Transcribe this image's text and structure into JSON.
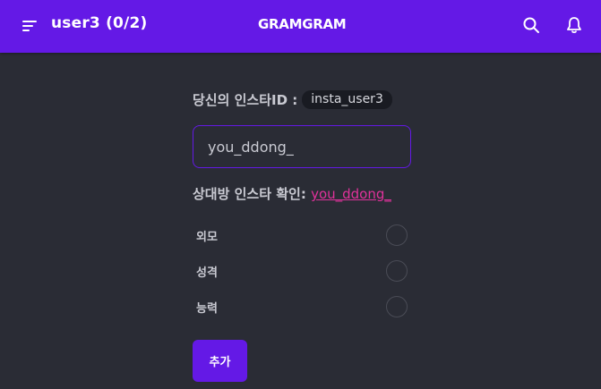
{
  "header": {
    "title": "user3 (0/2)",
    "brand": "GRAMGRAM",
    "icons": {
      "menu": "menu-icon",
      "search": "search-icon",
      "notifications": "bell-icon"
    }
  },
  "form": {
    "my_id_label": "당신의 인스타ID :",
    "my_id_value": "insta_user3",
    "target_input_value": "you_ddong_",
    "confirm_label": "상대방 인스타 확인:",
    "confirm_link": "you_ddong_",
    "options": [
      {
        "label": "외모",
        "checked": false
      },
      {
        "label": "성격",
        "checked": false
      },
      {
        "label": "능력",
        "checked": false
      }
    ],
    "add_button": "추가"
  },
  "colors": {
    "primary": "#6419e6",
    "background": "#2a2c35",
    "link": "#e0329b",
    "chip": "#191b22"
  }
}
